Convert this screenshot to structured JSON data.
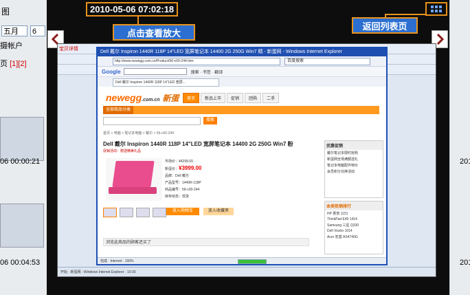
{
  "viewer": {
    "timestamp": "2010-05-06 07:02:18",
    "zoom_hint": "点击查看放大",
    "back_to_list": "返回列表页"
  },
  "background": {
    "left_title": "图",
    "month_select": "五月",
    "day_select": "6",
    "account_label": "摄帐户",
    "page_label": "页",
    "page_numbers": "[1][2]",
    "times": [
      "06 00:00:21",
      "06 00:04:53"
    ],
    "right_years": [
      "201",
      "201"
    ]
  },
  "screenshot": {
    "back_window_title": "宝贝详情",
    "ie_title": "Dell 戴尔 Inspiron 1440R 118P 14\"LED 宽屏笔记本 14400 2G 250G Win7 精 - 新蛋网 - Windows Internet Explorer",
    "address": "http://www.newegg.com.cn/Product/56-c00-244.htm",
    "search_placeholder": "百度搜索",
    "google_label": "Google",
    "toolbar_text": "搜索 · 书签 · 翻译",
    "tab_label": "Dell 戴尔 Inspiron 1440R 118P 14\"LED 宽屏...",
    "site": {
      "logo_text": "newegg",
      "logo_sub": ".com.cn",
      "logo_cn": "新蛋",
      "nav": [
        "首页",
        "新品上市",
        "促销",
        "团购",
        "二手"
      ],
      "category_button": "全部商品分类",
      "search_button": "搜索",
      "breadcrumb": "首页 > 电脑 > 笔记本电脑 > 戴尔 > 56-c00-244",
      "product_title": "Dell 戴尔 Inspiron 1440R 118P 14\"LED 宽屏笔记本 14400 2G 250G Win7 粉",
      "product_subtitle": "促销活动：赠送精美礼品",
      "specs": [
        "市场价：¥4299.00",
        "新蛋价：",
        "¥3999.00",
        "品牌：Dell 戴尔",
        "产品型号：1440R-118P",
        "商品编号：56-c00-244",
        "库存状态：现货"
      ],
      "buy_button": "放入购物车",
      "fav_button": "放入收藏夹",
      "sidebar_title": "优惠促销",
      "sidebar_lines": [
        "戴尔笔记本限时抢购",
        "新蛋网全场满额送礼",
        "笔记本电脑配件特价",
        "会员积分兑换活动"
      ],
      "rank_title": "本类热销排行",
      "rank_lines": [
        "HP 惠普 1151",
        "ThinkPad E40 1414",
        "Samsung 三星 Q330",
        "Dell Vostro 1014",
        "Acer 宏基 AS4740G"
      ],
      "recent_label": "浏览此商品的顾客还买了"
    },
    "status_text": "完成 · Internet · 100%",
    "progress_percent": 100,
    "taskbar_text": "开始 · 新蛋网 - Windows Internet Explorer · 10:30"
  }
}
